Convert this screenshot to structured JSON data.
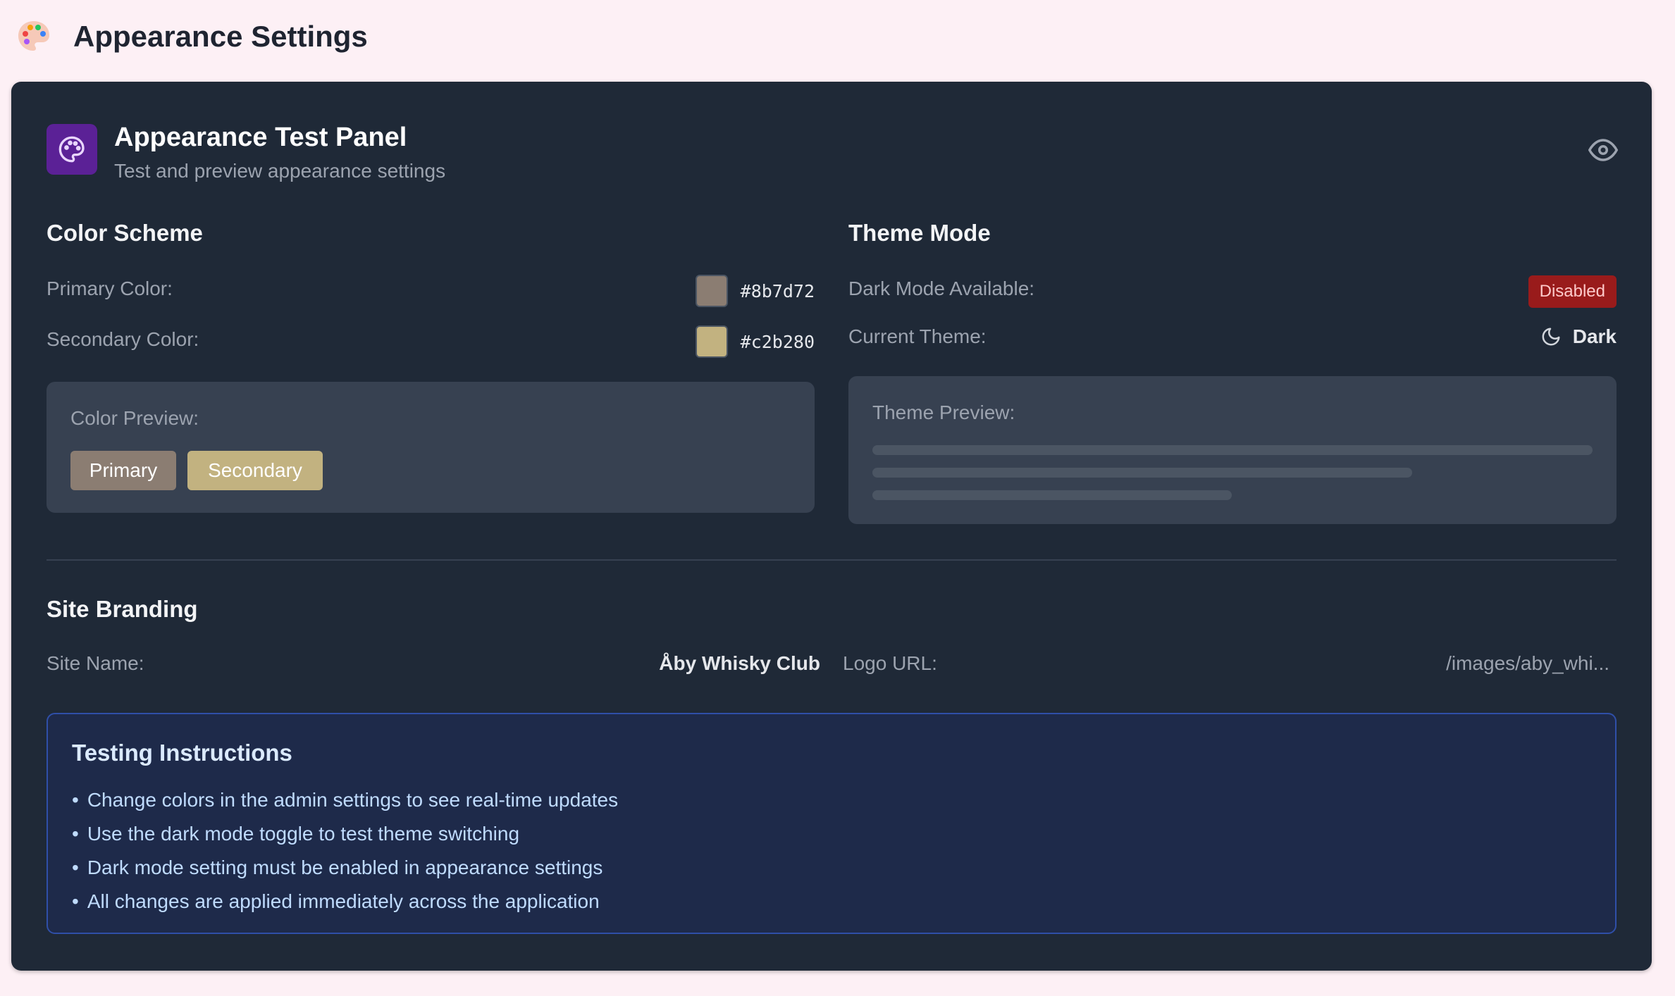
{
  "page": {
    "title": "Appearance Settings",
    "icon": "palette-icon"
  },
  "panel": {
    "title": "Appearance Test Panel",
    "subtitle": "Test and preview appearance settings",
    "icon": "palette-icon",
    "action_icon": "eye-icon"
  },
  "color_scheme": {
    "title": "Color Scheme",
    "primary_label": "Primary Color:",
    "primary_value": "#8b7d72",
    "secondary_label": "Secondary Color:",
    "secondary_value": "#c2b280",
    "preview_label": "Color Preview:",
    "primary_chip": "Primary",
    "secondary_chip": "Secondary"
  },
  "theme_mode": {
    "title": "Theme Mode",
    "dark_available_label": "Dark Mode Available:",
    "dark_available_status": "Disabled",
    "current_theme_label": "Current Theme:",
    "current_theme_value": "Dark",
    "current_theme_icon": "moon-icon",
    "preview_label": "Theme Preview:"
  },
  "site_branding": {
    "title": "Site Branding",
    "site_name_label": "Site Name:",
    "site_name_value": "Åby Whisky Club",
    "logo_url_label": "Logo URL:",
    "logo_url_value": "/images/aby_whi..."
  },
  "instructions": {
    "title": "Testing Instructions",
    "items": [
      "Change colors in the admin settings to see real-time updates",
      "Use the dark mode toggle to test theme switching",
      "Dark mode setting must be enabled in appearance settings",
      "All changes are applied immediately across the application"
    ]
  },
  "colors": {
    "page_bg": "#fdf0f5",
    "panel_bg": "#1f2937",
    "accent_purple": "#5b2196",
    "disabled_red": "#991b1b"
  }
}
